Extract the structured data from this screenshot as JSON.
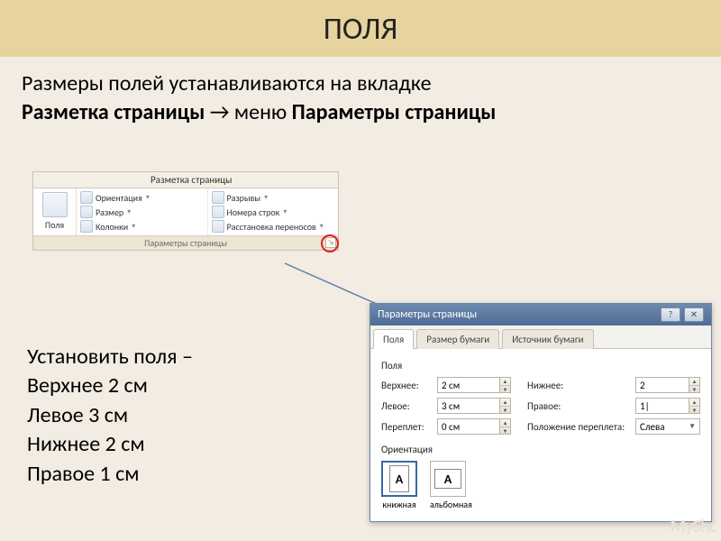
{
  "title": "ПОЛЯ",
  "intro": {
    "line1": "Размеры полей устанавливаются на вкладке",
    "tab_name": "Разметка страницы",
    "arrow": " → ",
    "menu_word": "меню ",
    "menu_name": "Параметры страницы"
  },
  "ribbon": {
    "tab": "Разметка страницы",
    "big_button": "Поля",
    "col1": [
      "Ориентация",
      "Размер",
      "Колонки"
    ],
    "col2": [
      "Разрывы",
      "Номера строк",
      "Расстановка переносов"
    ],
    "group": "Параметры страницы"
  },
  "instr": {
    "l1": "Установить поля –",
    "l2": "Верхнее 2 см",
    "l3": "Левое 3 см",
    "l4": "Нижнее 2 см",
    "l5": "Правое 1 см"
  },
  "dialog": {
    "title": "Параметры страницы",
    "tabs": [
      "Поля",
      "Размер бумаги",
      "Источник бумаги"
    ],
    "group_fields": "Поля",
    "fields": {
      "top_label": "Верхнее:",
      "top_val": "2 см",
      "bottom_label": "Нижнее:",
      "bottom_val": "2",
      "left_label": "Левое:",
      "left_val": "3 см",
      "right_label": "Правое:",
      "right_val": "1|",
      "gutter_label": "Переплет:",
      "gutter_val": "0 см",
      "gutter_pos_label": "Положение переплета:",
      "gutter_pos_val": "Слева"
    },
    "group_orient": "Ориентация",
    "orient": {
      "portrait": "книжная",
      "landscape": "альбомная"
    }
  },
  "watermark": "MyShc"
}
